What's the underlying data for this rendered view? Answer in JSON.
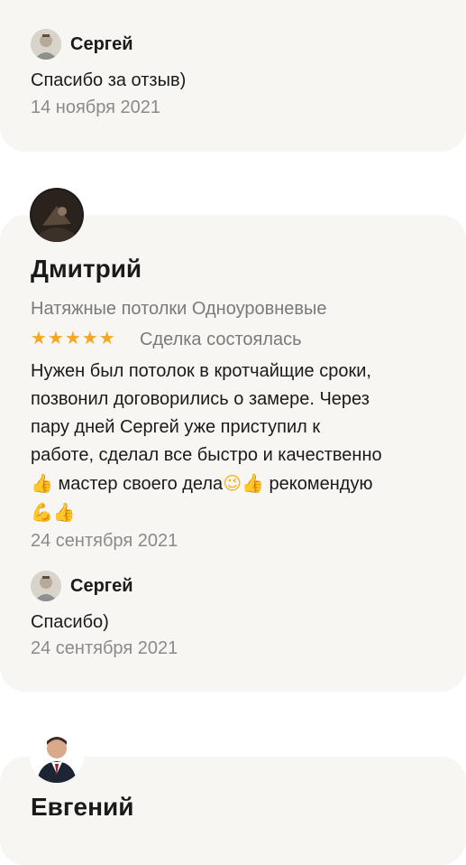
{
  "reviews": [
    {
      "reply": {
        "author": "Сергей",
        "text": "Спасибо за отзыв)",
        "date": "14 ноября 2021"
      }
    },
    {
      "author": "Дмитрий",
      "service": "Натяжные потолки Одноуровневые",
      "rating": 5,
      "stars": "★★★★★",
      "deal_status": "Сделка состоялась",
      "body_lines": [
        "Нужен был потолок в кротчайщие сроки,",
        "позвонил договорились о замере. Через",
        "пару дней Сергей уже приступил к",
        "работе, сделал все быстро и качественно"
      ],
      "body_line5_a": " мастер своего дела",
      "body_line5_b": " рекомендую",
      "emoji": {
        "thumbs_up": "👍",
        "wink": "😉",
        "muscle": "💪"
      },
      "date": "24 сентября 2021",
      "reply": {
        "author": "Сергей",
        "text": "Спасибо)",
        "date": "24 сентября 2021"
      }
    },
    {
      "author": "Евгений"
    }
  ],
  "colors": {
    "card_bg": "#f7f6f2",
    "star": "#f5a623",
    "muted_text": "#8a8a8a"
  }
}
